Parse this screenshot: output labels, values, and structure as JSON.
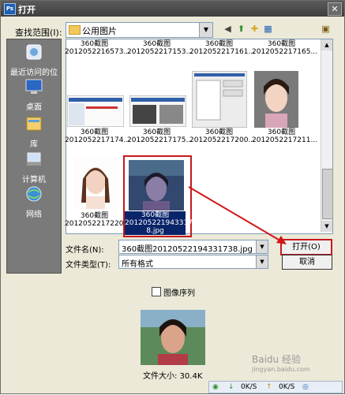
{
  "window": {
    "title": "打开",
    "app_icon": "Ps"
  },
  "lookin": {
    "label": "查找范围(I):",
    "value": "公用图片"
  },
  "places": [
    {
      "label": "最近访问的位置",
      "icon": "recent-icon"
    },
    {
      "label": "桌面",
      "icon": "desktop-icon"
    },
    {
      "label": "库",
      "icon": "library-icon"
    },
    {
      "label": "计算机",
      "icon": "computer-icon"
    },
    {
      "label": "网络",
      "icon": "network-icon"
    }
  ],
  "files": [
    {
      "name1": "360截图",
      "name2": "2012052216573..."
    },
    {
      "name1": "360截图",
      "name2": "2012052217153..."
    },
    {
      "name1": "360截图",
      "name2": "2012052217161..."
    },
    {
      "name1": "360截图",
      "name2": "2012052217165..."
    },
    {
      "name1": "360截图",
      "name2": "2012052217174..."
    },
    {
      "name1": "360截图",
      "name2": "2012052217175..."
    },
    {
      "name1": "360截图",
      "name2": "2012052217200..."
    },
    {
      "name1": "360截图",
      "name2": "2012052217211..."
    },
    {
      "name1": "360截图",
      "name2": "2012052217220..."
    }
  ],
  "selected_file": {
    "line1": "360截图",
    "line2": "2012052219433173",
    "line3": "8.jpg"
  },
  "filename": {
    "label": "文件名(N):",
    "value": "360截图20120522194331738.jpg"
  },
  "filetype": {
    "label": "文件类型(T):",
    "value": "所有格式"
  },
  "buttons": {
    "open": "打开(O)",
    "cancel": "取消"
  },
  "image_sequence": {
    "label": "图像序列"
  },
  "file_size": "文件大小: 30.4K",
  "statusbar": {
    "down": "0K/S",
    "up": "0K/S"
  },
  "watermark": "Baidu 经验",
  "watermark_url": "jingyan.baidu.com"
}
